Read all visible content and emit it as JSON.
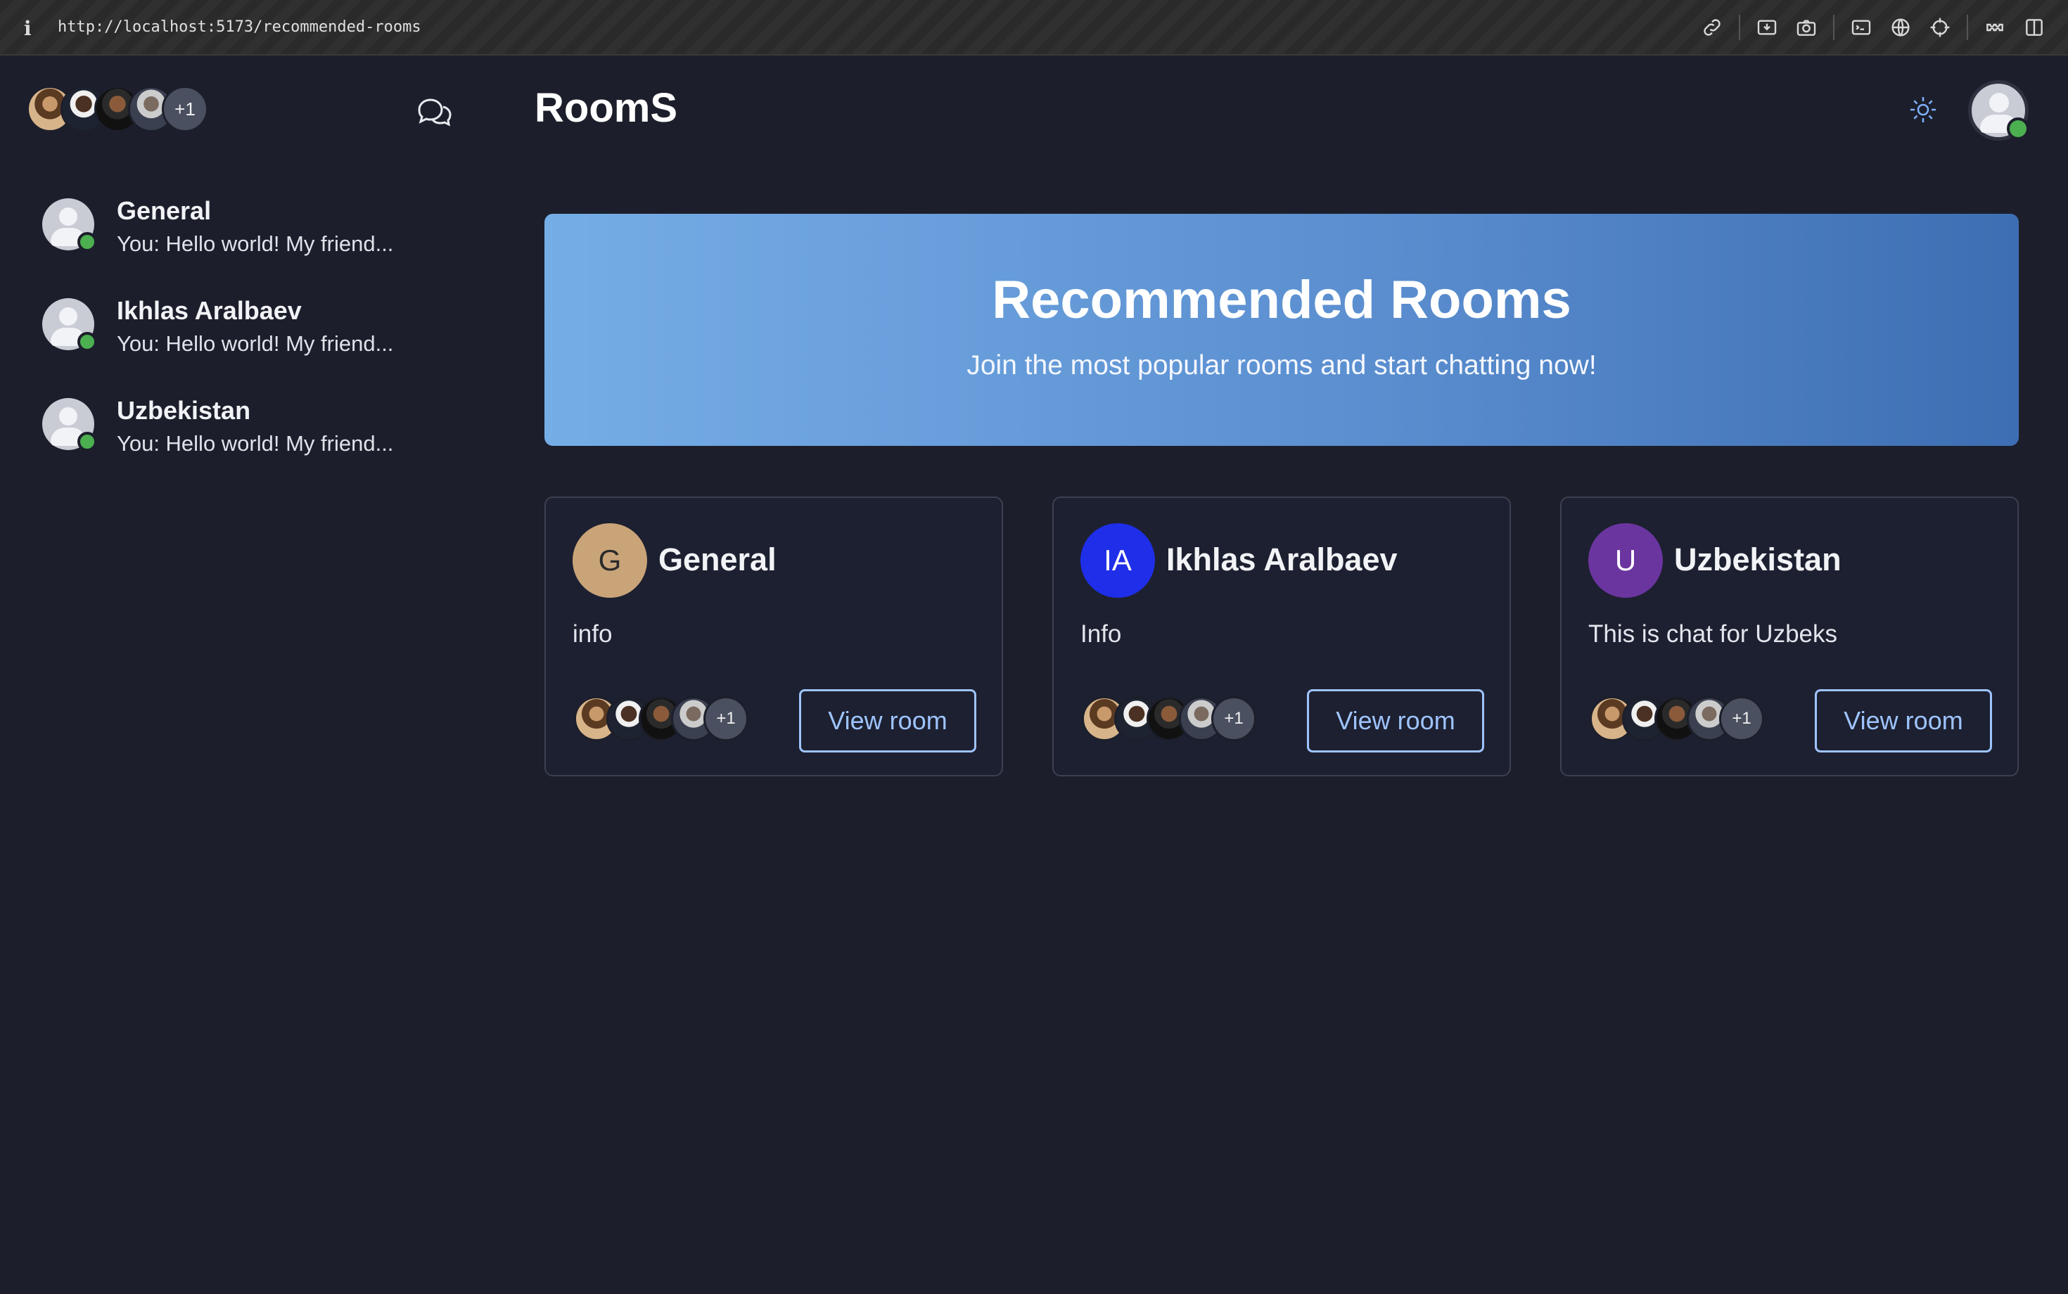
{
  "browser": {
    "url": "http://localhost:5173/recommended-rooms",
    "info_glyph": "i",
    "toolbar_icons": [
      "link-icon",
      "download-icon",
      "camera-icon",
      "terminal-icon",
      "globe-icon",
      "crosshair-icon",
      "extension-icon",
      "sidebar-icon"
    ]
  },
  "sidebar": {
    "avatar_stack_more": "+1",
    "rooms": [
      {
        "name": "General",
        "last_message": "You: Hello world! My friend..."
      },
      {
        "name": "Ikhlas Aralbaev",
        "last_message": "You: Hello world! My friend..."
      },
      {
        "name": "Uzbekistan",
        "last_message": "You: Hello world! My friend..."
      }
    ]
  },
  "header": {
    "title": "RoomS"
  },
  "banner": {
    "title": "Recommended Rooms",
    "subtitle": "Join the most popular rooms and start chatting now!"
  },
  "cards": [
    {
      "initials": "G",
      "name": "General",
      "description": "info",
      "members_more": "+1",
      "button": "View room",
      "color": "#c9a479"
    },
    {
      "initials": "IA",
      "name": "Ikhlas Aralbaev",
      "description": "Info",
      "members_more": "+1",
      "button": "View room",
      "color": "#1f2ee8"
    },
    {
      "initials": "U",
      "name": "Uzbekistan",
      "description": "This is chat for Uzbeks",
      "members_more": "+1",
      "button": "View room",
      "color": "#6b35a0"
    }
  ],
  "colors": {
    "background": "#1c1f2b",
    "accent": "#9ec4ff",
    "online": "#4caf50"
  }
}
